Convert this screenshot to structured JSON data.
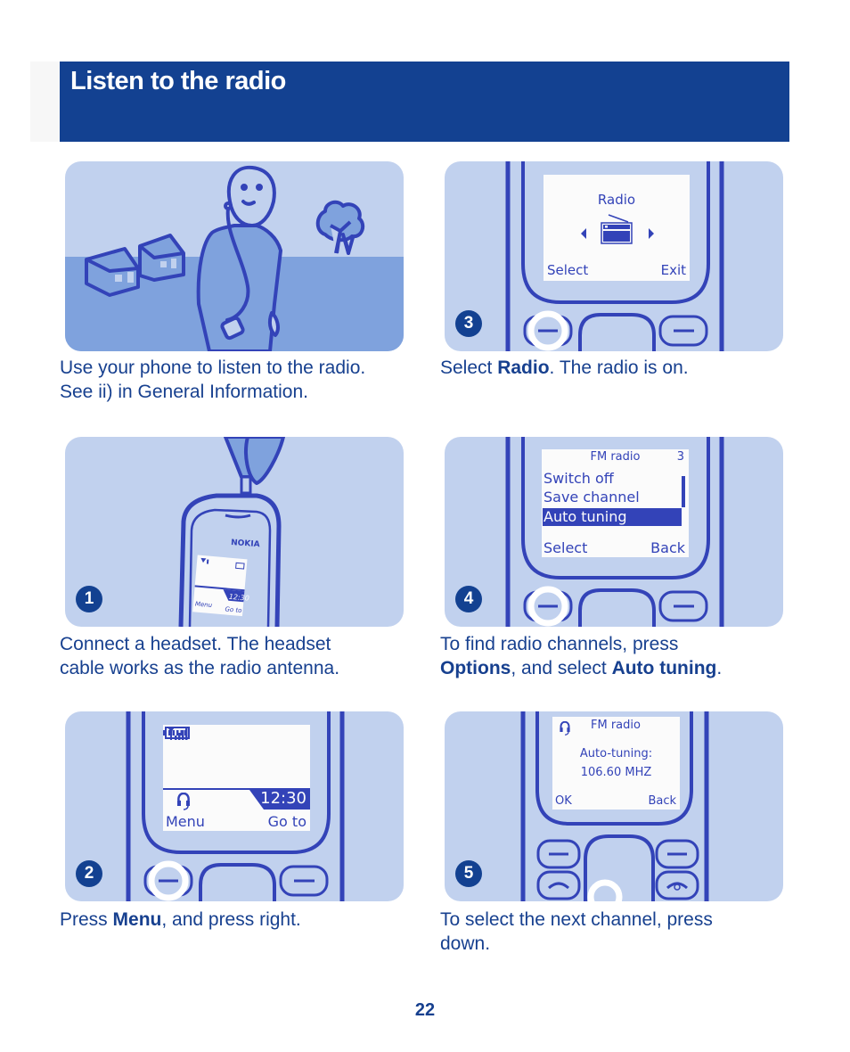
{
  "header": {
    "title": "Listen to the radio"
  },
  "colors": {
    "header_bg": "#134191",
    "panel_bg": "#c1d1ee",
    "line": "#3343b8",
    "text": "#17408f"
  },
  "panels": {
    "intro": {
      "caption_line1": "Use your phone to listen to the radio.",
      "caption_line2": "See ii) in General Information."
    },
    "step1": {
      "number": "1",
      "brand": "NOKIA",
      "screen_time": "12:30",
      "screen_left": "Menu",
      "screen_right": "Go to",
      "caption_line1": "Connect a headset. The headset",
      "caption_line2": "cable works as the radio antenna."
    },
    "step2": {
      "number": "2",
      "time": "12:30",
      "left_softkey": "Menu",
      "right_softkey": "Go to",
      "caption_pre": "Press ",
      "caption_bold": "Menu",
      "caption_post": ", and press right."
    },
    "step3": {
      "number": "3",
      "screen_title": "Radio",
      "left_softkey": "Select",
      "right_softkey": "Exit",
      "caption_pre": "Select ",
      "caption_bold": "Radio",
      "caption_post": ". The radio is on."
    },
    "step4": {
      "number": "4",
      "screen_title": "FM radio",
      "screen_index": "3",
      "menu_items": [
        "Switch off",
        "Save channel",
        "Auto tuning"
      ],
      "selected_item": "Auto tuning",
      "left_softkey": "Select",
      "right_softkey": "Back",
      "caption_line1": "To find radio channels, press",
      "caption_bold1": "Options",
      "caption_mid": ", and select ",
      "caption_bold2": "Auto tuning",
      "caption_end": "."
    },
    "step5": {
      "number": "5",
      "screen_title": "FM radio",
      "status_label": "Auto-tuning:",
      "frequency": "106.60 MHZ",
      "left_softkey": "OK",
      "right_softkey": "Back",
      "caption_line1": "To select the next channel, press",
      "caption_line2": "down."
    }
  },
  "footer": {
    "page_number": "22"
  }
}
